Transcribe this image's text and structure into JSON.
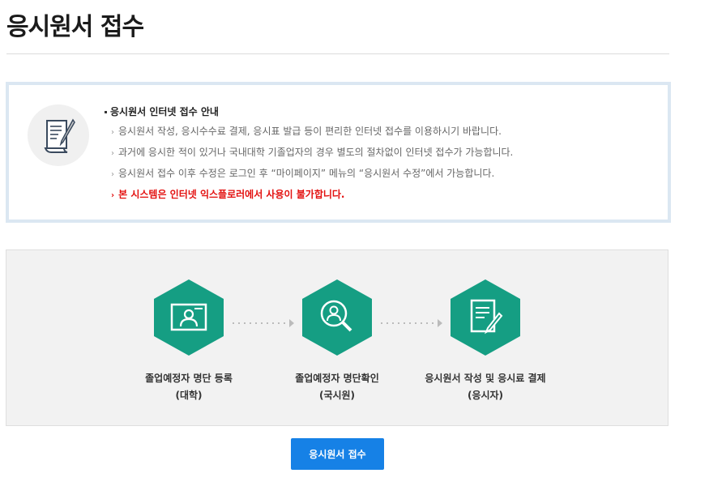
{
  "page": {
    "title": "응시원서 접수"
  },
  "notice": {
    "icon": "certificate-quill-icon",
    "heading": "응시원서 인터넷 접수 안내",
    "lines": [
      "응시원서 작성, 응시수수료 결제, 응시표 발급 등이 편리한 인터넷 접수를 이용하시기 바랍니다.",
      "과거에 응시한 적이 있거나 국내대학 기졸업자의 경우 별도의 절차없이 인터넷 접수가 가능합니다.",
      "응시원서 접수 이후 수정은 로그인 후 “마이페이지” 메뉴의 “응시원서 수정”에서 가능합니다."
    ],
    "warning": "본 시스템은 인터넷 익스플로러에서 사용이 불가합니다."
  },
  "process": {
    "accent_color": "#159e83",
    "steps": [
      {
        "label": "졸업예정자 명단 등록",
        "sub": "(대학)",
        "icon": "monitor-person-icon"
      },
      {
        "label": "졸업예정자 명단확인",
        "sub": "(국시원)",
        "icon": "magnifier-person-icon"
      },
      {
        "label": "응시원서 작성 및 응시료 결제",
        "sub": "(응시자)",
        "icon": "document-pen-icon"
      }
    ]
  },
  "submit": {
    "label": "응시원서 접수",
    "color": "#1681e6"
  }
}
